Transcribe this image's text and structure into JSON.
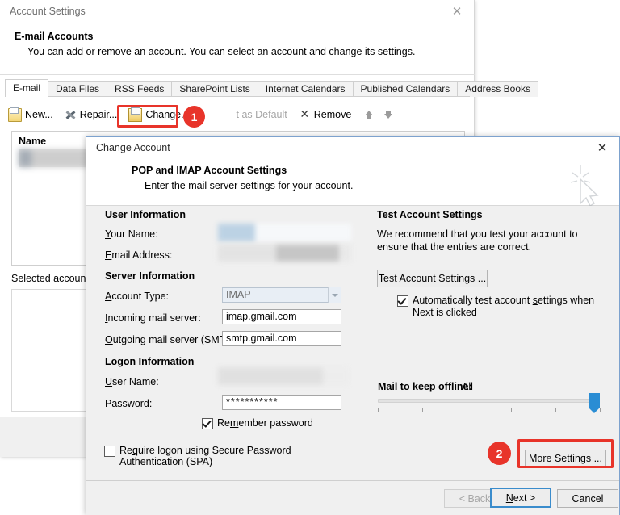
{
  "background_window": {
    "title": "Account Settings",
    "close_icon": "close-icon",
    "heading": "E-mail Accounts",
    "subheading": "You can add or remove an account. You can select an account and change its settings.",
    "tabs": [
      {
        "label": "E-mail",
        "active": true
      },
      {
        "label": "Data Files",
        "active": false
      },
      {
        "label": "RSS Feeds",
        "active": false
      },
      {
        "label": "SharePoint Lists",
        "active": false
      },
      {
        "label": "Internet Calendars",
        "active": false
      },
      {
        "label": "Published Calendars",
        "active": false
      },
      {
        "label": "Address Books",
        "active": false
      }
    ],
    "toolbar": {
      "new": "New...",
      "repair": "Repair...",
      "change": "Change...",
      "set_default": "t as Default",
      "remove": "Remove",
      "move_up_icon": "arrow-up-icon",
      "move_down_icon": "arrow-down-icon"
    },
    "list": {
      "column_header": "Name",
      "selected_row_value": ""
    },
    "selected_account_label": "Selected account de"
  },
  "dialog": {
    "title": "Change Account",
    "close_icon": "close-icon",
    "heading": "POP and IMAP Account Settings",
    "subheading": "Enter the mail server settings for your account.",
    "watermark_icon": "cursor-sparkle-icon",
    "user_information": {
      "group_label": "User Information",
      "your_name_label": "Your Name:",
      "your_name_value": "",
      "email_address_label": "Email Address:",
      "email_address_value": ""
    },
    "server_information": {
      "group_label": "Server Information",
      "account_type_label": "Account Type:",
      "account_type_value": "IMAP",
      "account_type_options": [
        "IMAP"
      ],
      "account_type_disabled": true,
      "incoming_label": "Incoming mail server:",
      "incoming_value": "imap.gmail.com",
      "outgoing_label": "Outgoing mail server (SMTP):",
      "outgoing_value": "smtp.gmail.com"
    },
    "logon_information": {
      "group_label": "Logon Information",
      "user_name_label": "User Name:",
      "user_name_value": "",
      "password_label": "Password:",
      "password_value": "***********",
      "remember_password_label": "Remember password",
      "remember_password_checked": true,
      "spa_label": "Require logon using Secure Password Authentication (SPA)",
      "spa_checked": false
    },
    "test_account_settings": {
      "group_label": "Test Account Settings",
      "description": "We recommend that you test your account to ensure that the entries are correct.",
      "test_button_label": "Test Account Settings ...",
      "auto_test_label": "Automatically test account settings when Next is clicked",
      "auto_test_checked": true
    },
    "mail_offline": {
      "label": "Mail to keep offline:",
      "value": "All",
      "tick_count": 6,
      "thumb_position_percent": 100
    },
    "more_settings_button": "More Settings ...",
    "footer": {
      "back_label": "< Back",
      "back_disabled": true,
      "next_label": "Next >",
      "next_focused": true,
      "cancel_label": "Cancel"
    }
  },
  "annotations": {
    "accent_color": "#e8342a",
    "markers": [
      {
        "number": "1",
        "target": "change-button"
      },
      {
        "number": "2",
        "target": "more-settings-button"
      }
    ]
  }
}
